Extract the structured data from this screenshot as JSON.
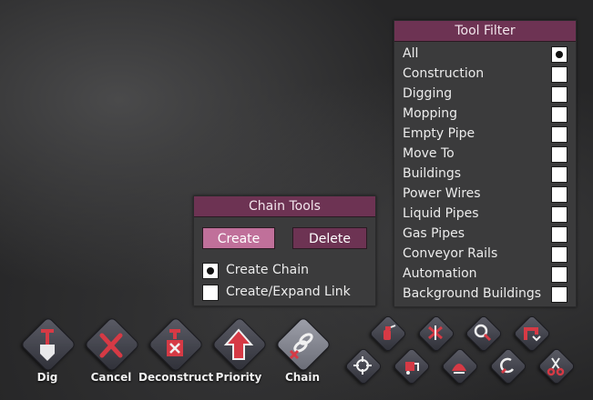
{
  "tool_filter": {
    "title": "Tool Filter",
    "items": [
      {
        "label": "All",
        "checked": true
      },
      {
        "label": "Construction",
        "checked": false
      },
      {
        "label": "Digging",
        "checked": false
      },
      {
        "label": "Mopping",
        "checked": false
      },
      {
        "label": "Empty Pipe",
        "checked": false
      },
      {
        "label": "Move To",
        "checked": false
      },
      {
        "label": "Buildings",
        "checked": false
      },
      {
        "label": "Power Wires",
        "checked": false
      },
      {
        "label": "Liquid Pipes",
        "checked": false
      },
      {
        "label": "Gas Pipes",
        "checked": false
      },
      {
        "label": "Conveyor Rails",
        "checked": false
      },
      {
        "label": "Automation",
        "checked": false
      },
      {
        "label": "Background Buildings",
        "checked": false
      }
    ]
  },
  "chain_tools": {
    "title": "Chain Tools",
    "create_label": "Create",
    "delete_label": "Delete",
    "options": [
      {
        "label": "Create Chain",
        "checked": true
      },
      {
        "label": "Create/Expand Link",
        "checked": false
      }
    ]
  },
  "toolbar": {
    "tools": [
      {
        "label": "Dig",
        "icon": "shovel-icon"
      },
      {
        "label": "Cancel",
        "icon": "cancel-x-icon"
      },
      {
        "label": "Deconstruct",
        "icon": "deconstruct-icon"
      },
      {
        "label": "Priority",
        "icon": "priority-arrow-icon"
      },
      {
        "label": "Chain",
        "icon": "chain-icon",
        "active": true
      }
    ],
    "small_tools": [
      {
        "icon": "mop-spray-icon"
      },
      {
        "icon": "disinfect-icon"
      },
      {
        "icon": "sweep-icon"
      },
      {
        "icon": "empty-pipe-icon"
      },
      {
        "icon": "attack-crosshair-icon"
      },
      {
        "icon": "capture-icon"
      },
      {
        "icon": "harvest-icon"
      },
      {
        "icon": "disconnect-icon"
      },
      {
        "icon": "scissors-icon"
      }
    ]
  },
  "colors": {
    "panel_header": "#6d3353",
    "create_button": "#c0709a",
    "icon_red": "#d63a45"
  }
}
